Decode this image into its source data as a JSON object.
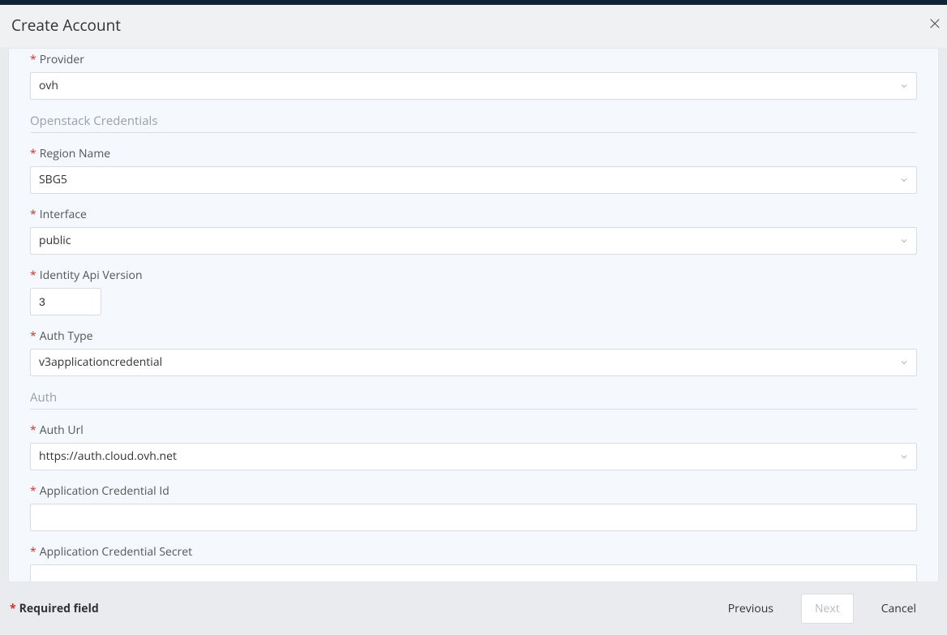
{
  "header": {
    "title": "Create Account"
  },
  "fields": {
    "provider": {
      "label": "Provider",
      "value": "ovh"
    },
    "section_openstack": "Openstack Credentials",
    "region_name": {
      "label": "Region Name",
      "value": "SBG5"
    },
    "interface": {
      "label": "Interface",
      "value": "public"
    },
    "identity_api_version": {
      "label": "Identity Api Version",
      "value": "3"
    },
    "auth_type": {
      "label": "Auth Type",
      "value": "v3applicationcredential"
    },
    "section_auth": "Auth",
    "auth_url": {
      "label": "Auth Url",
      "value": "https://auth.cloud.ovh.net"
    },
    "app_cred_id": {
      "label": "Application Credential Id",
      "value": ""
    },
    "app_cred_secret": {
      "label": "Application Credential Secret",
      "value": ""
    }
  },
  "footer": {
    "required_note": "Required field",
    "previous": "Previous",
    "next": "Next",
    "cancel": "Cancel"
  }
}
